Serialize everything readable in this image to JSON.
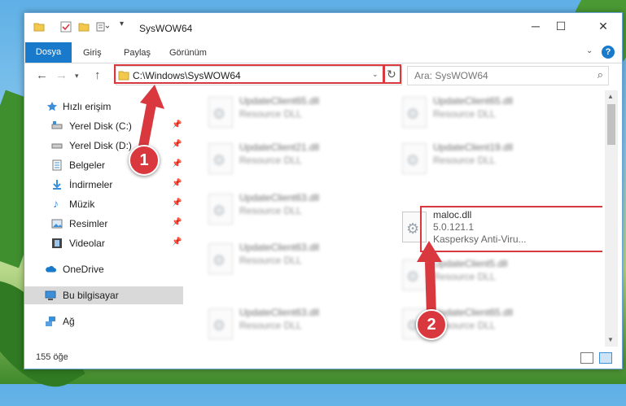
{
  "window": {
    "title": "SysWOW64"
  },
  "ribbon": {
    "tabs": [
      {
        "label": "Dosya"
      },
      {
        "label": "Giriş"
      },
      {
        "label": "Paylaş"
      },
      {
        "label": "Görünüm"
      }
    ],
    "help_label": "?"
  },
  "address": {
    "path": "C:\\Windows\\SysWOW64"
  },
  "search": {
    "placeholder": "Ara: SysWOW64"
  },
  "sidebar": {
    "quick_access": "Hızlı erişim",
    "items": [
      {
        "label": "Yerel Disk (C:)",
        "icon": "drive-icon",
        "pinned": true
      },
      {
        "label": "Yerel Disk (D:)",
        "icon": "drive-icon",
        "pinned": true
      },
      {
        "label": "Belgeler",
        "icon": "documents-icon",
        "pinned": true
      },
      {
        "label": "İndirmeler",
        "icon": "downloads-icon",
        "pinned": true
      },
      {
        "label": "Müzik",
        "icon": "music-icon",
        "pinned": true
      },
      {
        "label": "Resimler",
        "icon": "pictures-icon",
        "pinned": true
      },
      {
        "label": "Videolar",
        "icon": "videos-icon",
        "pinned": true
      }
    ],
    "onedrive": "OneDrive",
    "this_pc": "Bu bilgisayar",
    "network": "Ağ"
  },
  "files": [
    {
      "name": "UpdateClient65.dll",
      "sub": "Resource DLL"
    },
    {
      "name": "UpdateClient65.dll",
      "sub": "Resource DLL"
    },
    {
      "name": "UpdateClient21.dll",
      "sub": "Resource DLL"
    },
    {
      "name": "UpdateClient19.dll",
      "sub": "Resource DLL"
    },
    {
      "name": "UpdateClient63.dll",
      "sub": "Resource DLL"
    },
    {
      "name": "maloc.dll",
      "version": "5.0.121.1",
      "sub": "Kasperksy Anti-Viru..."
    },
    {
      "name": "UpdateClient63.dll",
      "sub": "Resource DLL"
    },
    {
      "name": "UpdateClient5.dll",
      "sub": "Resource DLL"
    },
    {
      "name": "UpdateClient63.dll",
      "sub": "Resource DLL"
    },
    {
      "name": "UpdateClient65.dll",
      "sub": "Resource DLL"
    }
  ],
  "status": {
    "count": "155 öğe"
  },
  "annotations": {
    "step1": "1",
    "step2": "2"
  },
  "colors": {
    "accent": "#1979ca",
    "highlight": "#d9393e"
  }
}
